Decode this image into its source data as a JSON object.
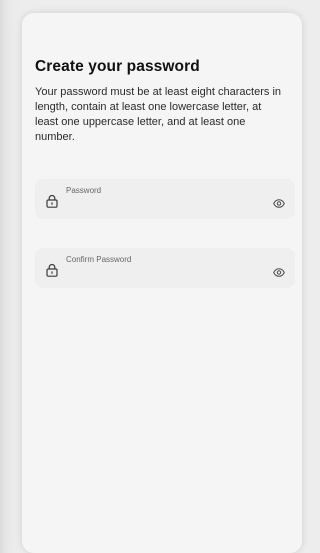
{
  "page": {
    "title": "Create your password",
    "description": "Your password must be at least eight characters in length, contain at least one lowercase letter, at least one uppercase letter, and at least one number."
  },
  "fields": {
    "password": {
      "label": "Password",
      "leading_icon": "lock-icon",
      "trailing_icon": "eye-icon"
    },
    "confirm_password": {
      "label": "Confirm Password",
      "leading_icon": "lock-icon",
      "trailing_icon": "eye-icon"
    }
  },
  "colors": {
    "card_background": "#f5f5f5",
    "field_background": "#efefef",
    "title_text": "#111111",
    "label_text": "#666666"
  }
}
